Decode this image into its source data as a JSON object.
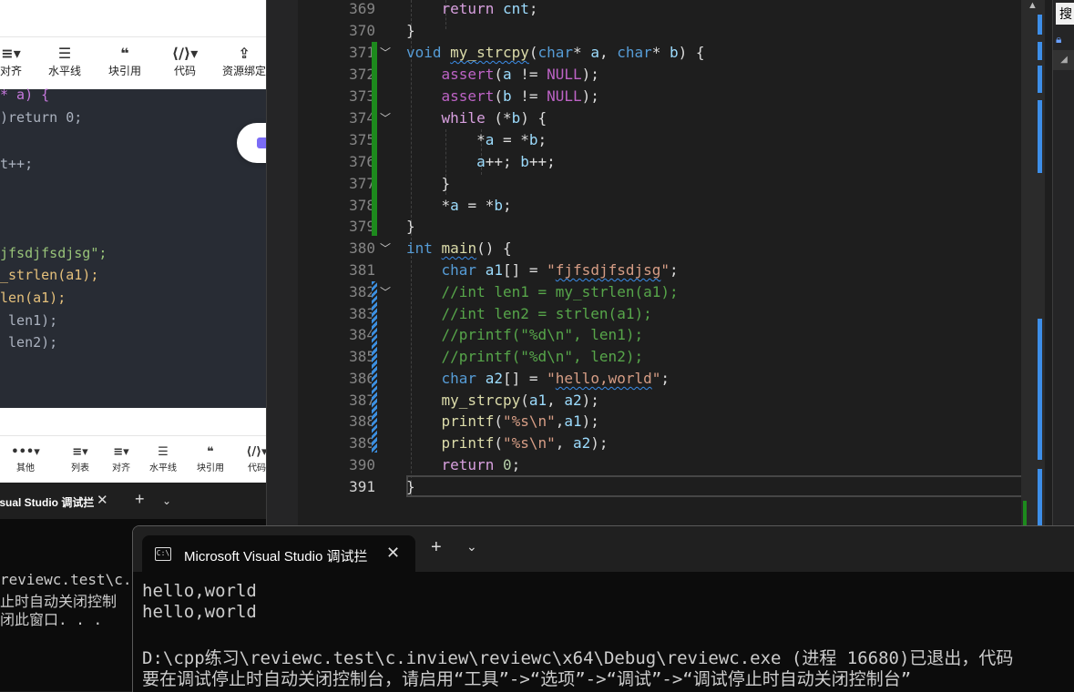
{
  "editor": {
    "toolbar_top": [
      {
        "icon": "≡▾",
        "label": "对齐"
      },
      {
        "icon": "☰",
        "label": "水平线"
      },
      {
        "icon": "❝",
        "label": "块引用"
      },
      {
        "icon": "⟨/⟩▾",
        "label": "代码"
      },
      {
        "icon": "⇪",
        "label": "资源绑定"
      }
    ],
    "toolbar_bottom": [
      {
        "icon": "•••▾",
        "label": "其他"
      },
      {
        "icon": "≡▾",
        "label": "列表"
      },
      {
        "icon": "≡▾",
        "label": "对齐"
      },
      {
        "icon": "☰",
        "label": "水平线"
      },
      {
        "icon": "❝",
        "label": "块引用"
      },
      {
        "icon": "⟨/⟩▾",
        "label": "代码"
      }
    ],
    "code_lines": [
      "* a) {",
      ")return 0;",
      "",
      "t++;",
      "",
      "",
      "",
      "jfsdjfsdjsg\";",
      "_strlen(a1);",
      "len(a1);",
      " len1);",
      " len2);"
    ]
  },
  "back_terminal": {
    "tab_title": "isual Studio 调试拦",
    "lines": [
      "reviewc.test\\c.",
      "止时自动关闭控制",
      "闭此窗口. . ."
    ]
  },
  "vs": {
    "line_numbers": [
      "369",
      "370",
      "371",
      "372",
      "373",
      "374",
      "375",
      "376",
      "377",
      "378",
      "379",
      "380",
      "381",
      "382",
      "383",
      "384",
      "385",
      "386",
      "387",
      "388",
      "389",
      "390",
      "391"
    ],
    "current_line": "391"
  },
  "right_panel": {
    "search_label": "搜"
  },
  "terminal": {
    "tab_title": "Microsoft Visual Studio 调试拦",
    "cmd_icon": "C:\\",
    "output": [
      "hello,world",
      "hello,world",
      "",
      "D:\\cpp练习\\reviewc.test\\c.inview\\reviewc\\x64\\Debug\\reviewc.exe (进程 16680)已退出，代码",
      "要在调试停止时自动关闭控制台，请启用“工具”->“选项”->“调试”->“调试停止时自动关闭控制台”"
    ]
  },
  "colors": {
    "keyword": "#569cd6",
    "control": "#d8a0df",
    "function": "#dcdcaa",
    "string": "#d69d85",
    "comment": "#57a64a",
    "change_green": "#1d8a1d",
    "change_blue": "#3d8ee8"
  }
}
